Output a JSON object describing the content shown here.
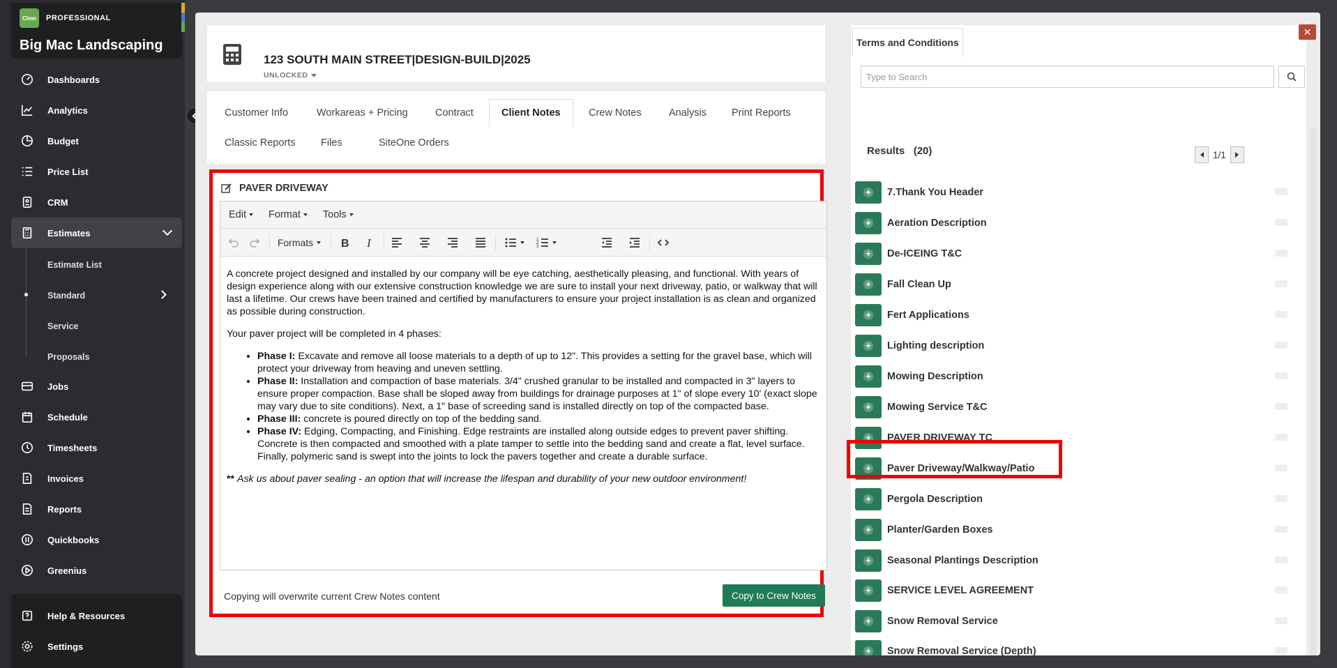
{
  "sidebar": {
    "brand_logo_text": "Clmn",
    "brand_tier": "PROFESSIONAL",
    "brand_name": "Big Mac Landscaping",
    "brand_bar_colors": [
      "#e5a623",
      "#4a7ec1",
      "#6aa84f"
    ],
    "items": [
      {
        "label": "Dashboards",
        "icon": "dashboard-icon"
      },
      {
        "label": "Analytics",
        "icon": "analytics-icon"
      },
      {
        "label": "Budget",
        "icon": "budget-icon"
      },
      {
        "label": "Price List",
        "icon": "list-icon"
      },
      {
        "label": "CRM",
        "icon": "crm-icon"
      },
      {
        "label": "Estimates",
        "icon": "calculator-icon"
      },
      {
        "label": "Jobs",
        "icon": "jobs-icon"
      },
      {
        "label": "Schedule",
        "icon": "calendar-icon"
      },
      {
        "label": "Timesheets",
        "icon": "clock-icon"
      },
      {
        "label": "Invoices",
        "icon": "invoice-icon"
      },
      {
        "label": "Reports",
        "icon": "reports-icon"
      },
      {
        "label": "Quickbooks",
        "icon": "quickbooks-icon"
      },
      {
        "label": "Greenius",
        "icon": "play-icon"
      }
    ],
    "subitems": [
      "Estimate List",
      "Standard",
      "Service",
      "Proposals"
    ],
    "bottom_items": [
      {
        "label": "Help & Resources",
        "icon": "help-icon"
      },
      {
        "label": "Settings",
        "icon": "gear-icon"
      }
    ]
  },
  "header": {
    "title": "123 SOUTH MAIN STREET|DESIGN-BUILD|2025",
    "status": "UNLOCKED"
  },
  "tabs": [
    "Customer Info",
    "Workareas + Pricing",
    "Contract",
    "Client Notes",
    "Crew Notes",
    "Analysis",
    "Print Reports",
    "Classic Reports",
    "Files",
    "SiteOne Orders"
  ],
  "note": {
    "title": "PAVER DRIVEWAY",
    "menus": [
      "Edit",
      "Format",
      "Tools"
    ],
    "formats_label": "Formats",
    "paragraph1": "A concrete project designed and installed by our company will be eye catching, aesthetically pleasing, and functional. With years of design experience along with our extensive construction knowledge we are sure to install your next driveway, patio, or walkway that will last a lifetime.  Our crews have been trained and certified by manufacturers to ensure your project installation is as clean and organized as possible during construction.",
    "paragraph2": "Your paver project will be completed in 4 phases:",
    "phases": [
      {
        "label": "Phase I:",
        "text": "  Excavate and remove all loose materials to a depth of up to 12\".  This provides a setting for the gravel base, which will protect your driveway from heaving and uneven settling."
      },
      {
        "label": "Phase II:",
        "text": "  Installation and compaction of base materials.  3/4\" crushed granular to be installed and compacted in 3\" layers to ensure proper compaction.  Base shall be sloped away from buildings for drainage purposes at 1\" of slope every 10' (exact slope may vary due to site conditions).  Next, a 1\" base of screeding sand is installed directly on top of the compacted base."
      },
      {
        "label": "Phase III:",
        "text": " concrete is poured directly on top of the bedding sand."
      },
      {
        "label": "Phase IV:",
        "text": " Edging, Compacting, and Finishing.  Edge restraints are installed along outside edges to prevent paver shifting.  Concrete is then compacted and smoothed with a plate tamper to settle into the bedding sand and create a flat, level surface.  Finally, polymeric sand is swept into the joints to lock the pavers together and create a durable surface."
      }
    ],
    "closing_prefix": "** ",
    "closing": "Ask us about paver sealing - an option that will increase the lifespan and durability of your new outdoor environment!",
    "copy_warning": "Copying will overwrite current Crew Notes content",
    "copy_button": "Copy to Crew Notes"
  },
  "right": {
    "tab_label": "Terms and Conditions",
    "search_placeholder": "Type to Search",
    "close_label": "✕",
    "results_label": "Results",
    "results_count": "(20)",
    "page": "1/1",
    "results": [
      "7.Thank You Header",
      "Aeration Description",
      "De-ICEING T&C",
      "Fall Clean Up",
      "Fert Applications",
      "Lighting description",
      "Mowing Description",
      "Mowing Service T&C",
      "PAVER DRIVEWAY TC",
      "Paver Driveway/Walkway/Patio",
      "Pergola Description",
      "Planter/Garden Boxes",
      "Seasonal Plantings Description",
      "SERVICE LEVEL AGREEMENT",
      "Snow Removal Service",
      "Snow Removal Service (Depth)"
    ]
  },
  "colors": {
    "accent_green": "#1f7a58",
    "highlight_red": "#ee0000",
    "sidebar_bg": "#2b2c2f"
  }
}
